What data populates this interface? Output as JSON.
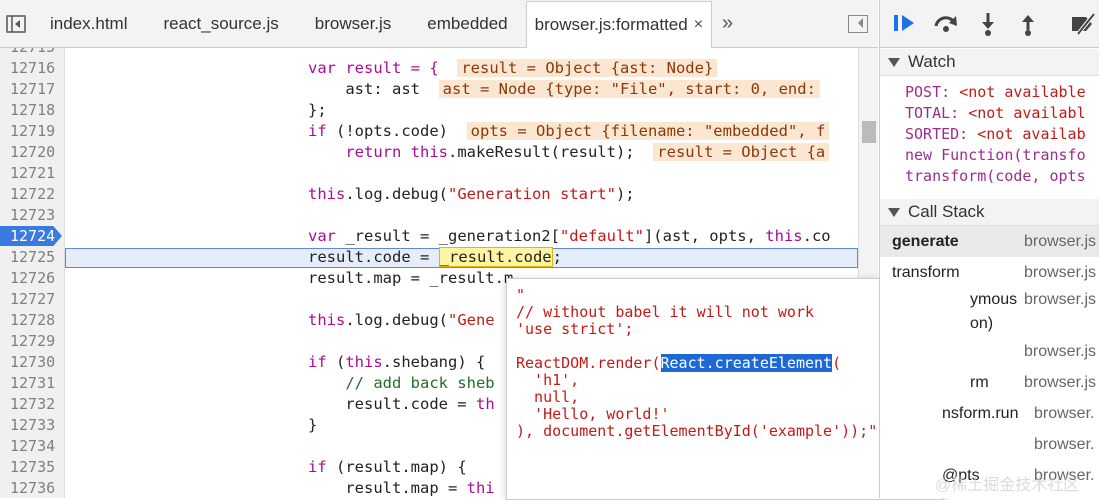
{
  "tabs": [
    "index.html",
    "react_source.js",
    "browser.js",
    "embedded",
    "browser.js:formatted"
  ],
  "tab_close": "×",
  "tab_more": "»",
  "lines": [
    {
      "n": "12715",
      "code": ""
    },
    {
      "n": "12716",
      "code": ""
    },
    {
      "n": "12717",
      "code": ""
    },
    {
      "n": "12718",
      "code": ""
    },
    {
      "n": "12719",
      "code": ""
    },
    {
      "n": "12720",
      "code": ""
    },
    {
      "n": "12721",
      "code": ""
    },
    {
      "n": "12722",
      "code": ""
    },
    {
      "n": "12723",
      "code": ""
    },
    {
      "n": "12724",
      "code": ""
    },
    {
      "n": "12725",
      "code": ""
    },
    {
      "n": "12726",
      "code": ""
    },
    {
      "n": "12727",
      "code": ""
    },
    {
      "n": "12728",
      "code": ""
    },
    {
      "n": "12729",
      "code": ""
    },
    {
      "n": "12730",
      "code": ""
    },
    {
      "n": "12731",
      "code": ""
    },
    {
      "n": "12732",
      "code": ""
    },
    {
      "n": "12733",
      "code": ""
    },
    {
      "n": "12734",
      "code": ""
    },
    {
      "n": "12735",
      "code": ""
    },
    {
      "n": "12736",
      "code": ""
    }
  ],
  "code": {
    "l12716": "var result = {",
    "l12716_inline": "result = Object {ast: Node}",
    "l12717": "    ast: ast",
    "l12717_inline": "ast = Node {type: \"File\", start: 0, end:",
    "l12718": "};",
    "l12719a": "if",
    "l12719b": " (!opts.code)",
    "l12719_inline": "opts = Object {filename: \"embedded\", f",
    "l12720a": "    return ",
    "l12720b": "this",
    "l12720c": ".makeResult(result);",
    "l12720_inline": "result = Object {a",
    "l12722a": "this",
    "l12722b": ".log.debug(",
    "l12722c": "\"Generation start\"",
    "l12722d": ");",
    "l12724a": "var",
    "l12724b": " _result = _generation2[",
    "l12724c": "\"default\"",
    "l12724d": "](ast, opts, ",
    "l12724e": "this",
    "l12724f": ".co",
    "l12725a": "result.code = ",
    "l12725b": "_result.code",
    "l12725c": ";",
    "l12726": "result.map = _result.m",
    "l12728a": "this",
    "l12728b": ".log.debug(",
    "l12728c": "\"Gene",
    "l12730a": "if",
    "l12730b": " (",
    "l12730c": "this",
    "l12730d": ".shebang) {",
    "l12731": "    // add back sheb",
    "l12732a": "    result.code = ",
    "l12732b": "th",
    "l12733": "}",
    "l12735a": "if",
    "l12735b": " (result.map) {",
    "l12736a": "    result.map = ",
    "l12736b": "thi"
  },
  "popover": {
    "l1": "\"",
    "l2": "// without babel it will not work",
    "l3": "'use strict';",
    "l4": "",
    "l5a": "ReactDOM.render(",
    "l5b": "React.createElement",
    "l5c": "(",
    "l6": "  'h1',",
    "l7": "  null,",
    "l8": "  'Hello, world!'",
    "l9": "), document.getElementById('example'));\""
  },
  "watch": {
    "title": "Watch",
    "items": [
      {
        "name": "POST: ",
        "value": "<not available"
      },
      {
        "name": "TOTAL: ",
        "value": "<not availabl"
      },
      {
        "name": "SORTED: ",
        "value": "<not availab"
      },
      {
        "name": "new Function(transfo",
        "value": ""
      },
      {
        "name": "transform(code, opts",
        "value": ""
      }
    ]
  },
  "callstack": {
    "title": "Call Stack",
    "rows": [
      {
        "fn": "generate",
        "src": "browser.js"
      },
      {
        "fn": "transform",
        "src": "browser.js"
      },
      {
        "fn": "ymous",
        "src": "browser.js"
      },
      {
        "fn": "on)",
        "src": ""
      },
      {
        "fn": "",
        "src": "browser.js"
      },
      {
        "fn": "rm",
        "src": "browser.js"
      },
      {
        "fn": "nsform.run",
        "src": "browser."
      },
      {
        "fn": "",
        "src": "browser."
      },
      {
        "fn": "@pts",
        "src": "browser."
      }
    ]
  },
  "watermark": "@稀土掘金技术社区"
}
